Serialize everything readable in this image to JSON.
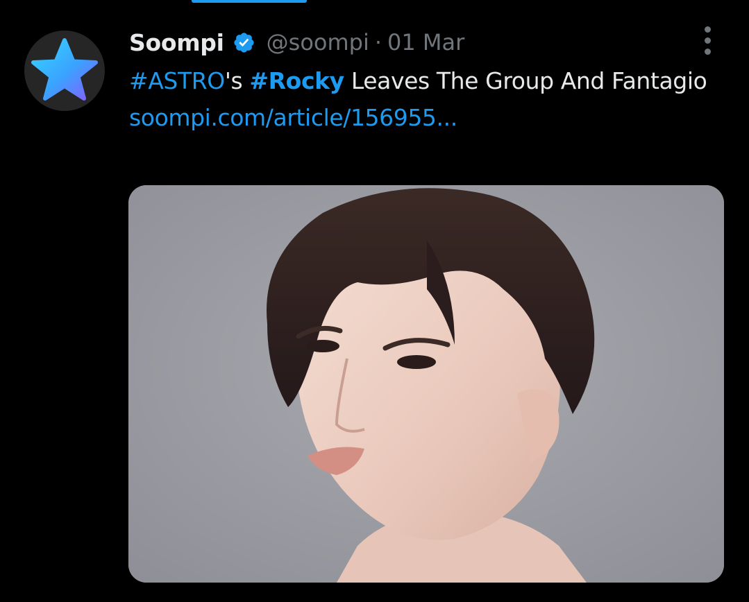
{
  "tweet": {
    "display_name": "Soompi",
    "handle": "@soompi",
    "separator": "·",
    "timestamp": "01 Mar",
    "text": {
      "tag1": "#ASTRO",
      "possessive": "'s ",
      "tag2": "#Rocky",
      "rest": " Leaves The Group And Fantagio",
      "link": "soompi.com/article/156955..."
    },
    "avatar_icon": "star-logo-icon",
    "verified_icon": "verified-badge-icon",
    "more_icon": "more-options-icon",
    "media_subject": "portrait-photo"
  },
  "colors": {
    "background": "#000000",
    "primary_text": "#e7e9ea",
    "secondary_text": "#71767b",
    "accent": "#1d9bf0"
  }
}
